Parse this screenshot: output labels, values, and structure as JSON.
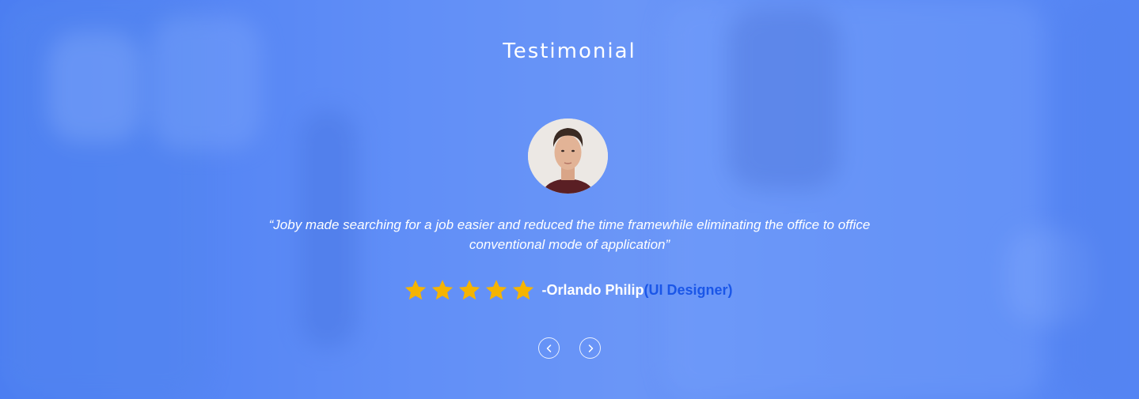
{
  "section": {
    "title": "Testimonial"
  },
  "testimonial": {
    "quote": "“Joby made searching for a job easier and reduced the time framewhile eliminating the office to office conventional mode of application”",
    "rating": 5,
    "rating_max": 5,
    "author": "-Orlando Philip",
    "role": "(UI Designer)",
    "avatar_icon": "person-portrait"
  },
  "navigation": {
    "prev_icon": "chevron-left-icon",
    "next_icon": "chevron-right-icon"
  },
  "colors": {
    "background": "#6f9af7",
    "star": "#f5b400",
    "role_text": "#1a56e8",
    "text": "#ffffff"
  }
}
